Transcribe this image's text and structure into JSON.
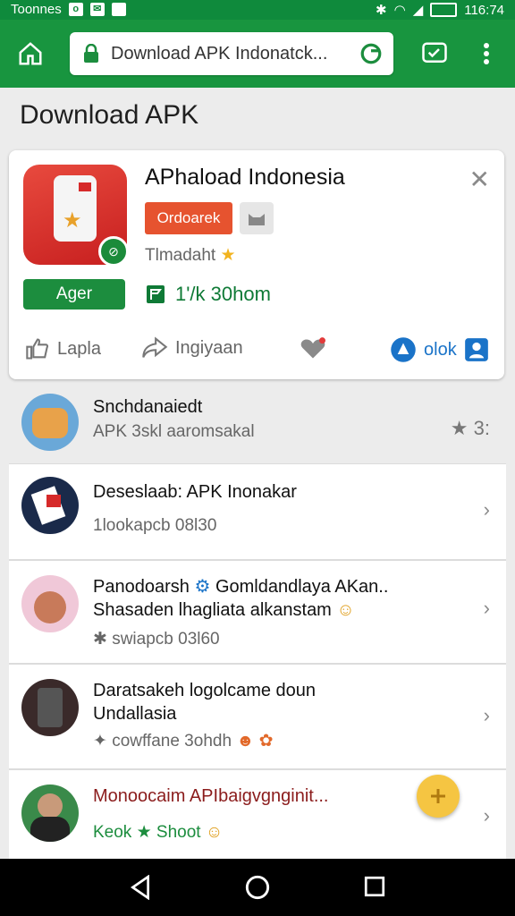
{
  "status": {
    "left_text": "Toonnes",
    "time": "116:74"
  },
  "browser": {
    "url_text": "Download APK Indonatck..."
  },
  "page": {
    "title": "Download APK"
  },
  "card": {
    "title": "APhaload Indonesia",
    "tag": "Ordoarek",
    "subtitle": "Tlmadaht",
    "action_label": "Ager",
    "count_text": "1'/k 30hom",
    "bottom_like": "Lapla",
    "bottom_share": "Ingiyaan",
    "bottom_right": "olok"
  },
  "list": [
    {
      "title": "Snchdanaiedt",
      "subtitle": "APK 3skl aaromsakal",
      "side": "3:"
    },
    {
      "title": "Deseslaab: APK Inonakar",
      "subtitle": "1lookapcb 08l30"
    },
    {
      "title": "Panodoarsh",
      "title_rest": "Gomldandlaya AKan..",
      "line2": "Shasaden lhagliata alkanstam",
      "subtitle": "swiapcb 03l60"
    },
    {
      "title": "Daratsakeh logolcame doun",
      "line2": "Undallasia",
      "subtitle": "cowffane 3ohdh"
    },
    {
      "title": "Monoocaim APIbaigvgnginit...",
      "subtitle": "Keok",
      "subtitle_rest": "Shoot"
    }
  ],
  "colors": {
    "header": "#18953f",
    "status": "#0f8a3c",
    "accent_red": "#e6532f",
    "accent_green": "#1c8d3e",
    "fab": "#f5c542",
    "blue": "#1a73c8"
  },
  "icons": [
    "home-icon",
    "lock-icon",
    "reload-icon",
    "tabs-icon",
    "more-vert-icon",
    "close-icon",
    "like-icon",
    "share-icon",
    "heart-icon",
    "fab-icon",
    "back-icon",
    "home-nav-icon",
    "recents-icon"
  ]
}
